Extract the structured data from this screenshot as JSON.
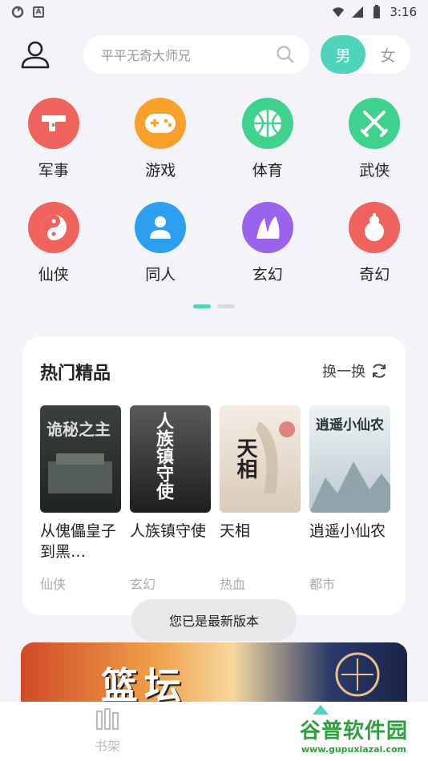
{
  "status_bar": {
    "time": "3:16",
    "icons": [
      "sync-icon",
      "a-box-icon",
      "wifi-icon",
      "signal-icon",
      "battery-icon"
    ]
  },
  "header": {
    "search_placeholder": "平平无奇大师兄",
    "gender": {
      "male": "男",
      "female": "女",
      "selected": "male"
    }
  },
  "categories": [
    {
      "label": "军事",
      "icon": "pistol-icon",
      "color": "#f0625c"
    },
    {
      "label": "游戏",
      "icon": "gamepad-icon",
      "color": "#f7a02a"
    },
    {
      "label": "体育",
      "icon": "basketball-icon",
      "color": "#3fd28e"
    },
    {
      "label": "武侠",
      "icon": "crossed-swords-icon",
      "color": "#3fd28e"
    },
    {
      "label": "仙侠",
      "icon": "yin-yang-icon",
      "color": "#f0625c"
    },
    {
      "label": "同人",
      "icon": "person-icon",
      "color": "#2c9ff0"
    },
    {
      "label": "玄幻",
      "icon": "mountain-icon",
      "color": "#9a63ee"
    },
    {
      "label": "奇幻",
      "icon": "gourd-icon",
      "color": "#f0625c"
    }
  ],
  "pager": {
    "pages": 2,
    "current": 1
  },
  "hot": {
    "title": "热门精品",
    "refresh_label": "换一换",
    "books": [
      {
        "title": "从傀儡皇子到黑…",
        "tag": "仙侠",
        "cover_text": "诡秘之主",
        "cover_color": "#2e3430"
      },
      {
        "title": "人族镇守使",
        "tag": "玄幻",
        "cover_text": "人族镇守使",
        "cover_color": "#3a3a3a"
      },
      {
        "title": "天相",
        "tag": "热血",
        "cover_text": "天相",
        "cover_color": "#efe6dc"
      },
      {
        "title": "逍遥小仙农",
        "tag": "都市",
        "cover_text": "逍遥小仙农",
        "cover_color": "#dfe8ec"
      }
    ]
  },
  "toast": "您已是最新版本",
  "banner": {
    "text": "篮坛"
  },
  "bottom_nav": {
    "shelf_label": "书架"
  },
  "watermark": {
    "main": "谷普软件园",
    "sub": "www.gupuxiazai.com"
  }
}
